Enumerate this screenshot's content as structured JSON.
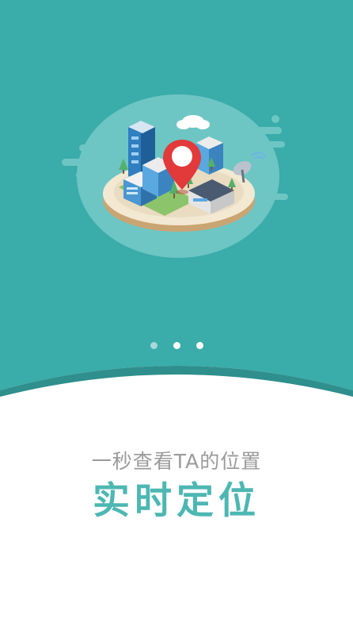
{
  "colors": {
    "hero_background": "#3aacaa",
    "accent": "#4db7b2",
    "subtitle_text": "#9a9a9a",
    "page_background": "#ffffff"
  },
  "hero": {
    "illustration": "city-map-location-pin",
    "pagination": {
      "total": 3,
      "active_index": 1
    }
  },
  "onboarding": {
    "subtitle": "一秒查看TA的位置",
    "title": "实时定位"
  }
}
